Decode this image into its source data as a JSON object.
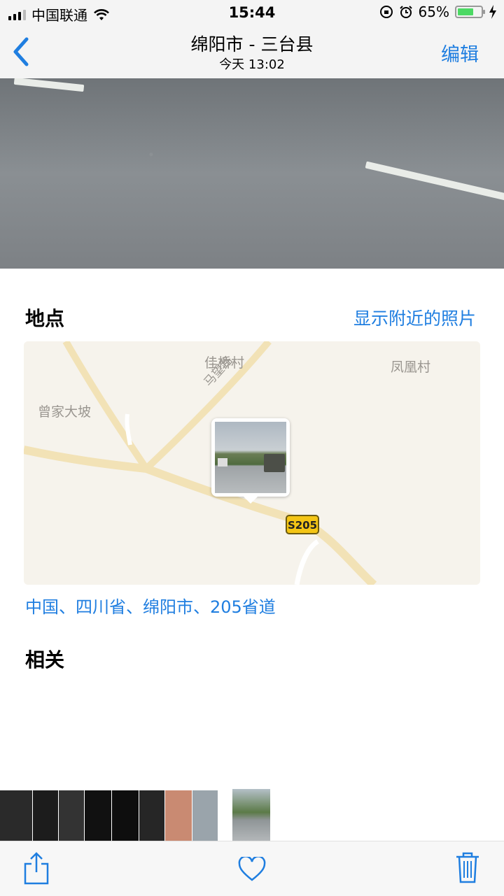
{
  "status_bar": {
    "carrier": "中国联通",
    "time": "15:44",
    "battery_percent": "65%",
    "battery_level": 0.65
  },
  "nav": {
    "title": "绵阳市 - 三台县",
    "subtitle": "今天  13:02",
    "edit_label": "编辑"
  },
  "location_section": {
    "title": "地点",
    "nearby_label": "显示附近的照片",
    "map_labels": [
      "佳桥村",
      "凤凰村",
      "曾家大坡",
      "马望路"
    ],
    "road_badge": "S205",
    "address": "中国、四川省、绵阳市、205省道"
  },
  "related_section": {
    "title": "相关"
  },
  "toolbar": {
    "share_icon": "share-icon",
    "favorite_icon": "heart-icon",
    "delete_icon": "trash-icon"
  },
  "colors": {
    "accent": "#1f7ee0",
    "battery": "#4cd964",
    "road_badge": "#f4c515"
  }
}
